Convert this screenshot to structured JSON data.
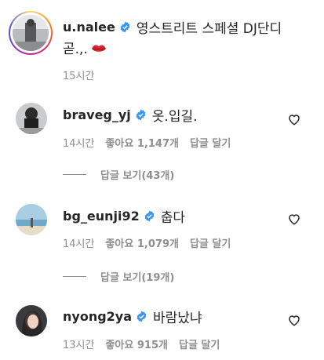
{
  "post": {
    "username": "u.nalee",
    "caption_line1": "영스트리트 스페셜 DJ단디",
    "caption_line2": "곧.,.",
    "caption_emoji": "lips-emoji",
    "time": "15시간"
  },
  "comments": [
    {
      "username": "braveg_yj",
      "text": "옷.입길.",
      "time": "14시간",
      "likes": "좋아요 1,147개",
      "reply_label": "답글 달기",
      "view_replies": "답글 보기(43개)"
    },
    {
      "username": "bg_eunji92",
      "text": "춥다",
      "time": "14시간",
      "likes": "좋아요 1,079개",
      "reply_label": "답글 달기",
      "view_replies": "답글 보기(19개)"
    },
    {
      "username": "nyong2ya",
      "text": "바람났냐",
      "time": "13시간",
      "likes": "좋아요 915개",
      "reply_label": "답글 달기"
    }
  ],
  "icons": {
    "verified": "verified-badge-icon",
    "heart": "heart-outline-icon"
  },
  "colors": {
    "verified_blue": "#3897f0",
    "meta_gray": "#8e8e8e",
    "text": "#262626"
  }
}
